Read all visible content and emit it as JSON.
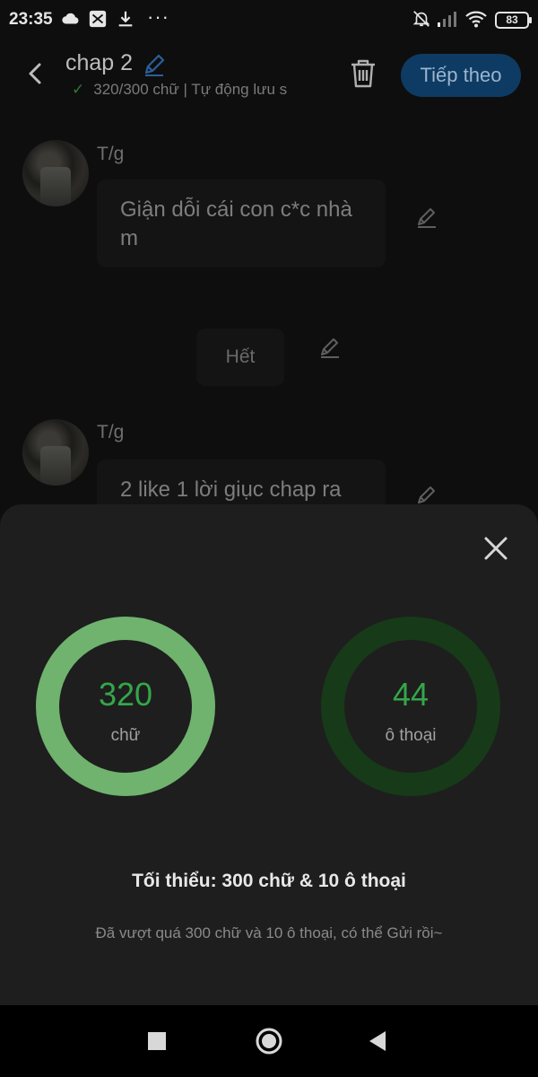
{
  "status_bar": {
    "time": "23:35",
    "battery": "83",
    "icons": [
      "cloud-icon",
      "app-notification-icon",
      "download-icon",
      "more-dots-icon",
      "mute-bell-icon",
      "signal-icon",
      "wifi-icon",
      "battery-icon"
    ]
  },
  "header": {
    "title": "chap 2",
    "subtitle": "320/300 chữ | Tự động lưu s",
    "next_label": "Tiếp theo"
  },
  "chat": {
    "messages": [
      {
        "sender": "T/g",
        "text": "Giận dỗi cái con c*c nhà m"
      },
      {
        "sender": "T/g",
        "text": "2 like 1 lời giục chap ra"
      }
    ],
    "end_chip": "Hết"
  },
  "stats": {
    "words": {
      "value": "320",
      "label": "chữ"
    },
    "dialogs": {
      "value": "44",
      "label": "ô thoại"
    },
    "minimum": "Tối thiểu: 300 chữ & 10 ô thoại",
    "note": "Đã vượt quá 300 chữ và 10 ô thoại, có thể Gửi rồi~"
  },
  "colors": {
    "accent_green": "#34a64a",
    "ring_words": "#6fb36e",
    "ring_dialogs": "#173a18",
    "next_button": "#0e3b63",
    "sheet_bg": "#1e1e1e"
  }
}
